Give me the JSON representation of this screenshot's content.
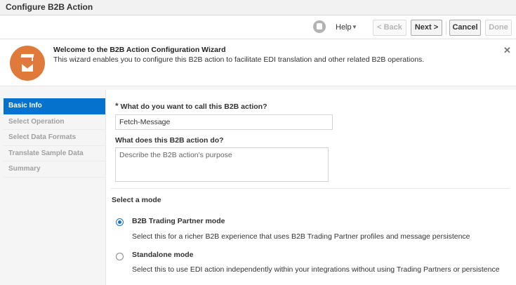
{
  "window": {
    "title": "Configure B2B Action"
  },
  "toolbar": {
    "help_label": "Help",
    "back_label": "< Back",
    "next_label": "Next >",
    "cancel_label": "Cancel",
    "done_label": "Done"
  },
  "banner": {
    "title": "Welcome to the B2B Action Configuration Wizard",
    "description": "This wizard enables you to configure this B2B action to facilitate EDI translation and other related B2B operations.",
    "close": "✕",
    "icon_color": "#e07a3a"
  },
  "nav": {
    "items": [
      {
        "label": "Basic Info",
        "active": true
      },
      {
        "label": "Select Operation",
        "active": false
      },
      {
        "label": "Select Data Formats",
        "active": false
      },
      {
        "label": "Translate Sample Data",
        "active": false
      },
      {
        "label": "Summary",
        "active": false
      }
    ],
    "active_color": "#0572ce"
  },
  "form": {
    "name_required_mark": "*",
    "name_label": "What do you want to call this B2B action?",
    "name_value": "Fetch-Message",
    "desc_label": "What does this B2B action do?",
    "desc_placeholder": "Describe the B2B action's purpose",
    "mode_label": "Select a mode",
    "modes": [
      {
        "title": "B2B Trading Partner mode",
        "description": "Select this for a richer B2B experience that uses B2B Trading Partner profiles and message persistence",
        "selected": true
      },
      {
        "title": "Standalone mode",
        "description": "Select this to use EDI action independently within your integrations without using Trading Partners or persistence",
        "selected": false
      }
    ]
  }
}
